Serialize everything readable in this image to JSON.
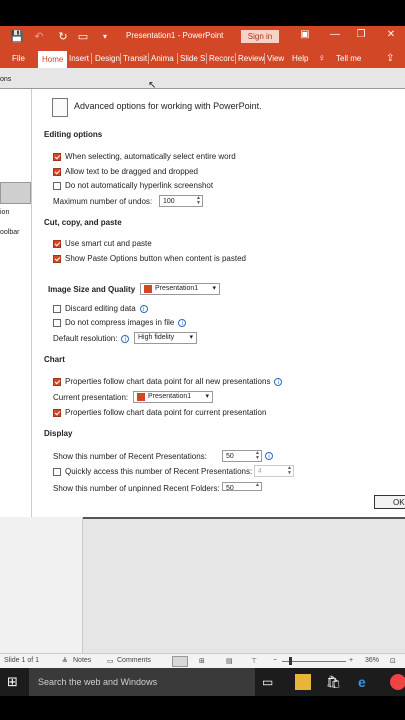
{
  "titlebar": {
    "title": "Presentation1 - PowerPoint",
    "sign_in": "Sign in",
    "minimize": "—",
    "restore": "❐",
    "close": "✕"
  },
  "ribbon": {
    "tabs": [
      "File",
      "Home",
      "Insert",
      "Design",
      "Transit",
      "Anima",
      "Slide S",
      "Recorc",
      "Review",
      "View",
      "Help"
    ],
    "tell_me": "Tell me"
  },
  "nav": {
    "items": [
      "ons",
      "ion",
      "oolbar"
    ]
  },
  "dialog": {
    "header_text": "Advanced options for working with PowerPoint.",
    "sections": {
      "editing": {
        "title": "Editing options",
        "opt1": "When selecting, automatically select entire word",
        "opt2": "Allow text to be dragged and dropped",
        "opt3": "Do not automatically hyperlink screenshot",
        "undo_label": "Maximum number of undos:",
        "undo_value": "100"
      },
      "ccp": {
        "title": "Cut, copy, and paste",
        "opt1": "Use smart cut and paste",
        "opt2": "Show Paste Options button when content is pasted"
      },
      "image": {
        "title": "Image Size and Quality",
        "file": "Presentation1",
        "opt1": "Discard editing data",
        "opt2": "Do not compress images in file",
        "res_label": "Default resolution:",
        "res_value": "High fidelity"
      },
      "chart": {
        "title": "Chart",
        "opt1": "Properties follow chart data point for all new presentations",
        "current_label": "Current presentation:",
        "current_value": "Presentation1",
        "opt2": "Properties follow chart data point for current presentation"
      },
      "display": {
        "title": "Display",
        "recent_label": "Show this number of Recent Presentations:",
        "recent_value": "50",
        "quick_label": "Quickly access this number of Recent Presentations:",
        "quick_value": "4",
        "unpinned_label": "Show this number of unpinned Recent Folders:",
        "unpinned_value": "50"
      }
    },
    "ok": "OK"
  },
  "status": {
    "slide": "Slide 1 of 1",
    "notes": "Notes",
    "comments": "Comments",
    "zoom": "36%"
  },
  "taskbar": {
    "search_placeholder": "Search the web and Windows"
  }
}
